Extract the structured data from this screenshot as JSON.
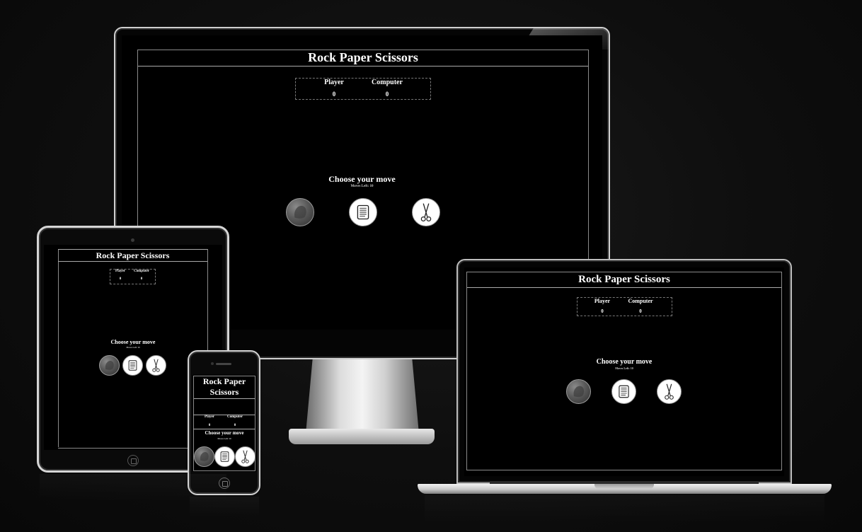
{
  "app": {
    "title": "Rock Paper Scissors",
    "title_phone_line1": "Rock Paper",
    "title_phone_line2": "Scissors"
  },
  "score": {
    "player_label": "Player",
    "computer_label": "Computer",
    "player_value": "0",
    "computer_value": "0"
  },
  "game": {
    "choose_label": "Choose your move",
    "moves_left": "Moves Left: 10"
  },
  "moves": [
    {
      "name": "rock",
      "icon": "rock-icon"
    },
    {
      "name": "paper",
      "icon": "paper-icon"
    },
    {
      "name": "scissors",
      "icon": "scissors-icon"
    }
  ],
  "devices": [
    "desktop-monitor",
    "tablet",
    "phone",
    "laptop"
  ]
}
